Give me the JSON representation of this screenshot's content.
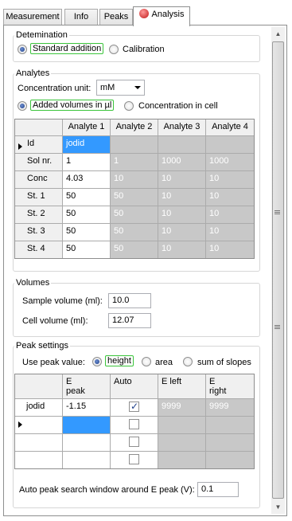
{
  "tabs": [
    {
      "label": "Measurement"
    },
    {
      "label": "Info"
    },
    {
      "label": "Peaks"
    },
    {
      "label": "Analysis"
    }
  ],
  "determination": {
    "title": "Detemination",
    "standard_addition": "Standard addition",
    "calibration": "Calibration",
    "selected": "standard_addition"
  },
  "analytes": {
    "title": "Analytes",
    "conc_unit_label": "Concentration unit:",
    "conc_unit_value": "mM",
    "added_volumes": "Added volumes in µl",
    "concentration_in_cell": "Concentration in cell",
    "selected": "added_volumes",
    "columns": [
      "Analyte 1",
      "Analyte 2",
      "Analyte 3",
      "Analyte 4"
    ],
    "rows": [
      {
        "label": "Id",
        "values": [
          "jodid",
          "",
          "",
          ""
        ]
      },
      {
        "label": "Sol nr.",
        "values": [
          "1",
          "1",
          "1000",
          "1000"
        ]
      },
      {
        "label": "Conc",
        "values": [
          "4.03",
          "10",
          "10",
          "10"
        ]
      },
      {
        "label": "St. 1",
        "values": [
          "50",
          "50",
          "10",
          "10"
        ]
      },
      {
        "label": "St. 2",
        "values": [
          "50",
          "50",
          "10",
          "10"
        ]
      },
      {
        "label": "St. 3",
        "values": [
          "50",
          "50",
          "10",
          "10"
        ]
      },
      {
        "label": "St. 4",
        "values": [
          "50",
          "50",
          "10",
          "10"
        ]
      }
    ]
  },
  "volumes": {
    "title": "Volumes",
    "sample_label": "Sample volume (ml):",
    "sample_value": "10.0",
    "cell_label": "Cell volume (ml):",
    "cell_value": "12.07"
  },
  "peak_settings": {
    "title": "Peak settings",
    "use_label": "Use peak value:",
    "height": "height",
    "area": "area",
    "slopes": "sum of slopes",
    "selected": "height",
    "col_epeak": "E\npeak",
    "col_e": "E",
    "col_peak": "peak",
    "col_auto": "Auto",
    "col_eleft": "E left",
    "col_right": "right",
    "rows": [
      {
        "label": "jodid",
        "epeak": "-1.15",
        "auto": true,
        "eleft": "9999",
        "eright": "9999"
      },
      {
        "label": "",
        "epeak": "",
        "auto": false,
        "eleft": "",
        "eright": ""
      },
      {
        "label": "",
        "epeak": "",
        "auto": false,
        "eleft": "",
        "eright": ""
      },
      {
        "label": "",
        "epeak": "",
        "auto": false,
        "eleft": "",
        "eright": ""
      }
    ],
    "window_label": "Auto peak search window around E peak (V):",
    "window_value": "0.1"
  }
}
